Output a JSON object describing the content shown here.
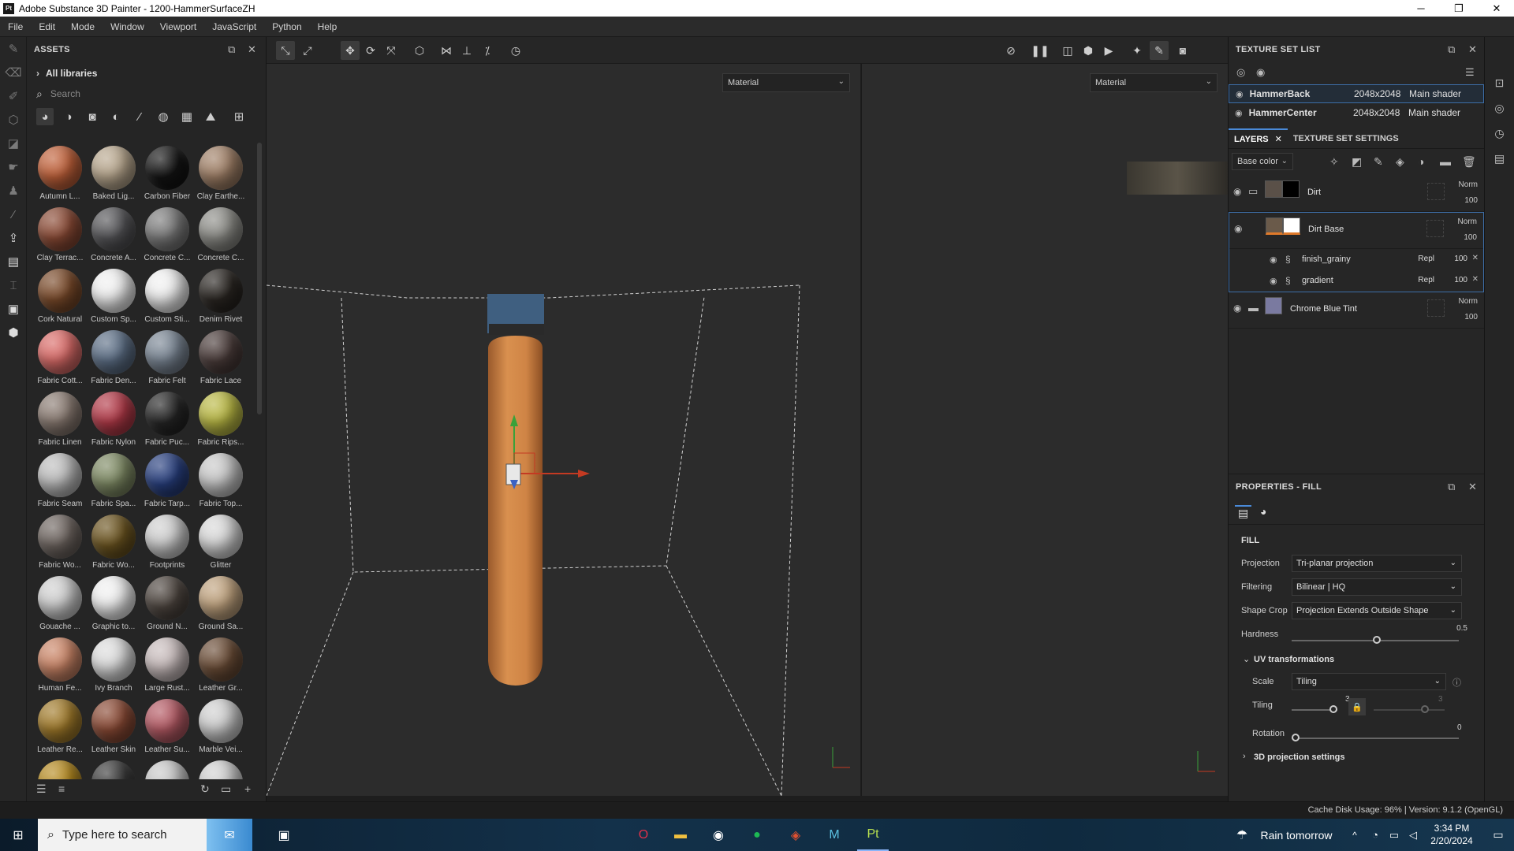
{
  "window": {
    "title": "Adobe Substance 3D Painter - 1200-HammerSurfaceZH",
    "app_icon": "Pt"
  },
  "menu": [
    "File",
    "Edit",
    "Mode",
    "Window",
    "Viewport",
    "JavaScript",
    "Python",
    "Help"
  ],
  "assets": {
    "title": "ASSETS",
    "library": "All libraries",
    "search_placeholder": "Search",
    "materials": [
      "Autumn L...",
      "Baked Lig...",
      "Carbon Fiber",
      "Clay Earthe...",
      "Clay Terrac...",
      "Concrete A...",
      "Concrete C...",
      "Concrete C...",
      "Cork Natural",
      "Custom Sp...",
      "Custom Sti...",
      "Denim Rivet",
      "Fabric Cott...",
      "Fabric Den...",
      "Fabric Felt",
      "Fabric Lace",
      "Fabric Linen",
      "Fabric Nylon",
      "Fabric Puc...",
      "Fabric Rips...",
      "Fabric Seam",
      "Fabric Spa...",
      "Fabric Tarp...",
      "Fabric Top...",
      "Fabric Wo...",
      "Fabric Wo...",
      "Footprints",
      "Glitter",
      "Gouache ...",
      "Graphic to...",
      "Ground N...",
      "Ground Sa...",
      "Human Fe...",
      "Ivy Branch",
      "Large Rust...",
      "Leather Gr...",
      "Leather Re...",
      "Leather Skin",
      "Leather Su...",
      "Marble Vei...",
      "",
      "",
      "",
      ""
    ],
    "colors": [
      "#c0613a",
      "#b8a78e",
      "#141414",
      "#a08067",
      "#8a4a35",
      "#555558",
      "#7b7b7b",
      "#8d8d88",
      "#7a4a2a",
      "#f0f0f0",
      "#f0f0f0",
      "#2a2622",
      "#d96b68",
      "#5d6f86",
      "#7a8694",
      "#4a3c3a",
      "#8a7b72",
      "#b23a48",
      "#262626",
      "#b9b844",
      "#bdbdbd",
      "#7e8a64",
      "#283f7e",
      "#c8c8c8",
      "#6e6560",
      "#6b5420",
      "#cfcfcf",
      "#d8d8d8",
      "#cfcfcf",
      "#f0f0f0",
      "#4e4640",
      "#bfa27e",
      "#c98466",
      "#dcdcdc",
      "#c8bcbc",
      "#6b4d37",
      "#a07a2a",
      "#8a4a35",
      "#b45a64",
      "#cfcfcf",
      "#b58a20",
      "#3a3a3a",
      "#c8c8c8",
      "#d0d0d0"
    ]
  },
  "viewport": {
    "left_channel": "Material",
    "right_channel": "Material"
  },
  "texture_set_list": {
    "title": "TEXTURE SET LIST",
    "rows": [
      {
        "name": "HammerBack",
        "res": "2048x2048",
        "shader": "Main shader"
      },
      {
        "name": "HammerCenter",
        "res": "2048x2048",
        "shader": "Main shader"
      }
    ]
  },
  "layers": {
    "tab_layers": "LAYERS",
    "tab_tss": "TEXTURE SET SETTINGS",
    "channel": "Base color",
    "items": [
      {
        "name": "Dirt",
        "blend": "Norm",
        "opacity": "100"
      },
      {
        "name": "Dirt Base",
        "blend": "Norm",
        "opacity": "100"
      },
      {
        "name": "Chrome Blue Tint",
        "blend": "Norm",
        "opacity": "100"
      }
    ],
    "effects": [
      {
        "name": "finish_grainy",
        "blend": "Repl",
        "opacity": "100"
      },
      {
        "name": "gradient",
        "blend": "Repl",
        "opacity": "100"
      }
    ]
  },
  "properties": {
    "title": "PROPERTIES - FILL",
    "section": "FILL",
    "projection_label": "Projection",
    "projection": "Tri-planar projection",
    "filtering_label": "Filtering",
    "filtering": "Bilinear | HQ",
    "shapecrop_label": "Shape Crop",
    "shapecrop": "Projection Extends Outside Shape",
    "hardness_label": "Hardness",
    "hardness": "0.5",
    "uv_label": "UV transformations",
    "scale_label": "Scale",
    "scale": "Tiling",
    "tiling_label": "Tiling",
    "tiling": "3",
    "tiling2": "3",
    "rotation_label": "Rotation",
    "rotation": "0",
    "proj3d_label": "3D projection settings"
  },
  "status": "Cache Disk Usage:    96% | Version: 9.1.2 (OpenGL)",
  "taskbar": {
    "search": "Type here to search",
    "weather": "Rain tomorrow",
    "time": "3:34 PM",
    "date": "2/20/2024"
  }
}
